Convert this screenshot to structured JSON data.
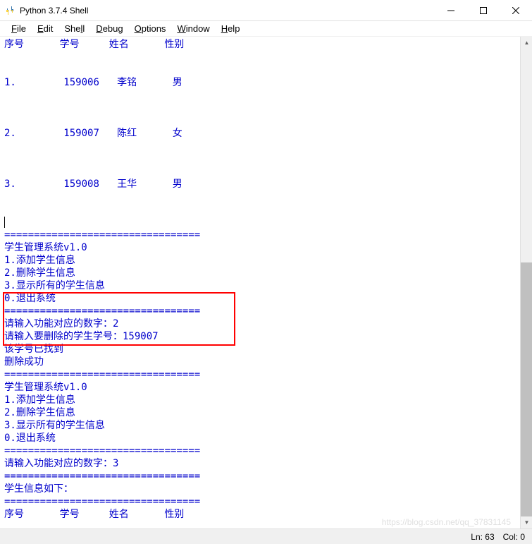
{
  "window": {
    "title": "Python 3.7.4 Shell"
  },
  "menu": {
    "file": "File",
    "edit": "Edit",
    "shell": "Shell",
    "debug": "Debug",
    "options": "Options",
    "window": "Window",
    "help": "Help"
  },
  "tableHeader": {
    "col1": "序号",
    "col2": "学号",
    "col3": "姓名",
    "col4": "性别"
  },
  "rows": [
    {
      "idx": "1.",
      "id": "159006",
      "name": "李铭",
      "gender": "男"
    },
    {
      "idx": "2.",
      "id": "159007",
      "name": "陈红",
      "gender": "女"
    },
    {
      "idx": "3.",
      "id": "159008",
      "name": "王华",
      "gender": "男"
    }
  ],
  "divider": "=================================",
  "menuBlock": {
    "title": "学生管理系统v1.0",
    "opt1": "1.添加学生信息",
    "opt2": "2.删除学生信息",
    "opt3": "3.显示所有的学生信息",
    "opt0": "0.退出系统"
  },
  "prompt1": {
    "line1_label": "请输入功能对应的数字：",
    "line1_val": "2",
    "line2_label": "请输入要删除的学生学号：",
    "line2_val": "159007",
    "line3": "该学号已找到",
    "line4": "删除成功"
  },
  "prompt2": {
    "label": "请输入功能对应的数字：",
    "val": "3"
  },
  "infoHeader": "学生信息如下：",
  "status": {
    "ln": "Ln: 63",
    "col": "Col: 0"
  },
  "watermark": "https://blog.csdn.net/qq_37831145"
}
